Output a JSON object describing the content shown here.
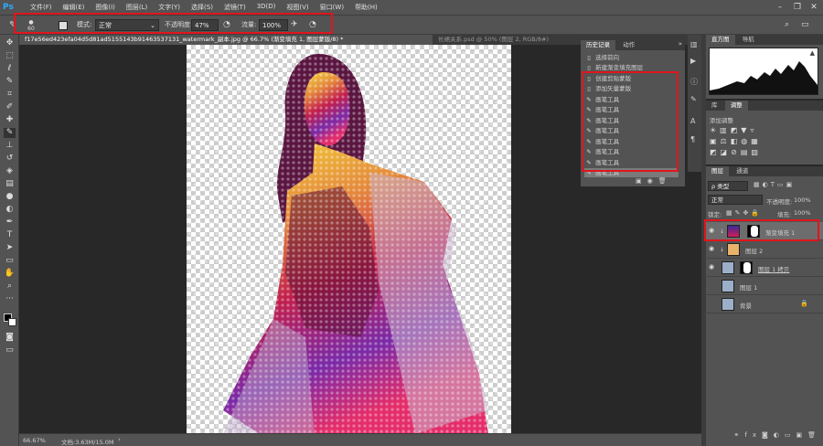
{
  "app": {
    "logo": "Ps"
  },
  "menu": [
    "文件(F)",
    "编辑(E)",
    "图像(I)",
    "图层(L)",
    "文字(Y)",
    "选择(S)",
    "滤镜(T)",
    "3D(D)",
    "视图(V)",
    "窗口(W)",
    "帮助(H)"
  ],
  "options": {
    "brush_size": "60",
    "mode_label": "模式:",
    "mode_value": "正常",
    "opacity_label": "不透明度:",
    "opacity_value": "47%",
    "flow_label": "流量:",
    "flow_value": "100%"
  },
  "doc_tabs": [
    "f17e56ed423efa04d5d81ad5155143b91463537131_watermark_副本.jpg @ 66.7% (渐变填充 1, 图层蒙版/8) *",
    "长裙关系.psd @ 50% (图层 2, RGB/8#)"
  ],
  "history": {
    "tabs": [
      "历史记录",
      "动作"
    ],
    "items": [
      "选择前向",
      "新建渐变填充图层",
      "创建剪贴蒙版",
      "添加矢量蒙版",
      "画笔工具",
      "画笔工具",
      "画笔工具",
      "画笔工具",
      "画笔工具",
      "画笔工具",
      "画笔工具",
      "画笔工具"
    ]
  },
  "histogram": {
    "tabs": [
      "直方图",
      "导航"
    ]
  },
  "adjust": {
    "tabs": [
      "库",
      "调整"
    ],
    "label": "添加调整"
  },
  "layers": {
    "tabs": [
      "图层",
      "通道"
    ],
    "filter_label": "ρ 类型",
    "blend": "正常",
    "opacity_label": "不透明度:",
    "opacity_value": "100%",
    "lock_label": "锁定:",
    "fill_label": "填充:",
    "fill_value": "100%",
    "items": [
      {
        "name": "渐变填充 1",
        "thumb": "#5a2aa0"
      },
      {
        "name": "图层 2",
        "thumb": "#e8b26a"
      },
      {
        "name": "图层 1 拷贝",
        "thumb": "#9bb0c8"
      },
      {
        "name": "图层 1",
        "thumb": "#9bb0c8"
      },
      {
        "name": "背景",
        "thumb": "#9bb0c8"
      }
    ]
  },
  "status": {
    "zoom": "66.67%",
    "doc": "文档:3.63M/15.0M"
  },
  "colors": {
    "accent_red": "#e0161c"
  }
}
